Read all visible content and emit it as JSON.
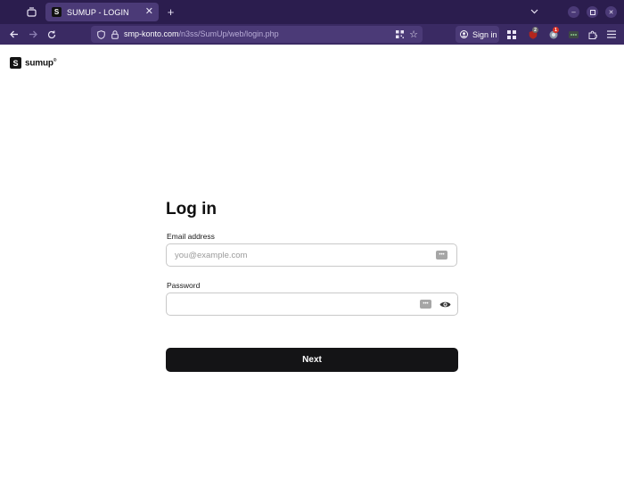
{
  "browser": {
    "tab": {
      "title": "SUMUP - LOGIN",
      "favicon_letter": "S"
    },
    "url": {
      "domain": "smp-konto.com",
      "path": "/n3ss/SumUp/web/login.php"
    },
    "signin_label": "Sign in",
    "badges": {
      "ext1": "2",
      "ext2": "1"
    },
    "colors": {
      "tabbar": "#2b1d4e",
      "toolbar": "#3a2a63",
      "accent": "#4b3a77"
    }
  },
  "page": {
    "logo_text": "sumup",
    "logo_mark": "S",
    "title": "Log in",
    "email": {
      "label": "Email address",
      "placeholder": "you@example.com",
      "value": ""
    },
    "password": {
      "label": "Password",
      "value": ""
    },
    "next_label": "Next",
    "colors": {
      "button": "#141416",
      "field_border": "#c9c9c9"
    }
  }
}
